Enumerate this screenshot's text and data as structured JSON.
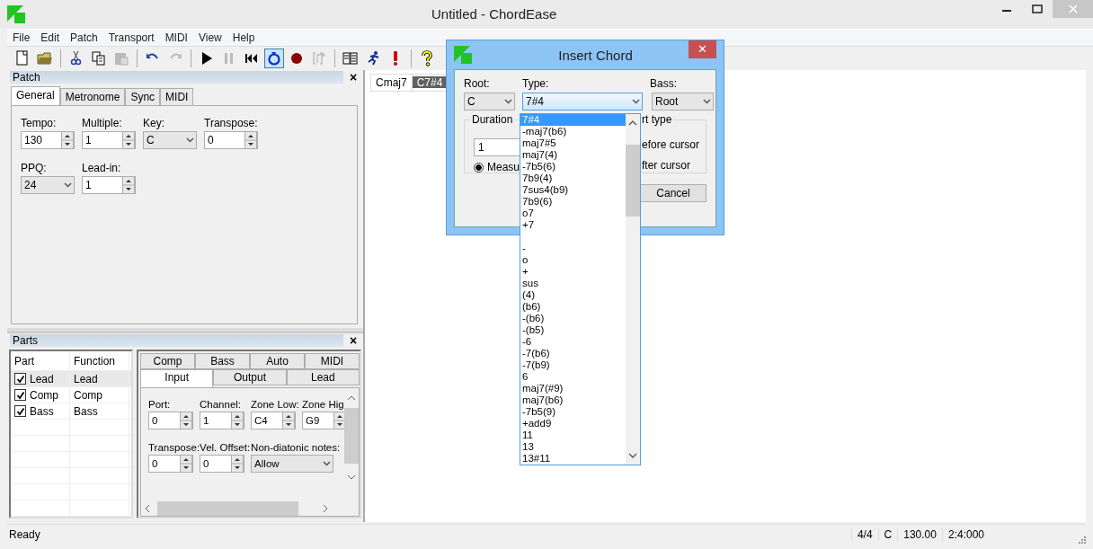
{
  "window": {
    "title": "Untitled - ChordEase"
  },
  "menu": [
    "File",
    "Edit",
    "Patch",
    "Transport",
    "MIDI",
    "View",
    "Help"
  ],
  "toolbar": [
    {
      "kind": "new",
      "disabled": false,
      "active": false
    },
    {
      "kind": "open",
      "disabled": false,
      "active": false
    },
    {
      "kind": "sep"
    },
    {
      "kind": "cut",
      "disabled": false,
      "active": false
    },
    {
      "kind": "copy",
      "disabled": false,
      "active": false
    },
    {
      "kind": "paste",
      "disabled": true,
      "active": false
    },
    {
      "kind": "sep"
    },
    {
      "kind": "undo",
      "disabled": false,
      "active": false
    },
    {
      "kind": "redo",
      "disabled": true,
      "active": false
    },
    {
      "kind": "sep"
    },
    {
      "kind": "play",
      "disabled": false,
      "active": false
    },
    {
      "kind": "pause",
      "disabled": true,
      "active": false
    },
    {
      "kind": "rewind",
      "disabled": false,
      "active": false
    },
    {
      "kind": "loop",
      "disabled": false,
      "active": true
    },
    {
      "kind": "record",
      "disabled": false,
      "active": false
    },
    {
      "kind": "punch",
      "disabled": true,
      "active": false
    },
    {
      "kind": "sep"
    },
    {
      "kind": "book",
      "disabled": false,
      "active": false
    },
    {
      "kind": "run",
      "disabled": false,
      "active": false
    },
    {
      "kind": "alert",
      "disabled": false,
      "active": false
    },
    {
      "kind": "sep"
    },
    {
      "kind": "help",
      "disabled": false,
      "active": false
    }
  ],
  "patch_panel": {
    "title": "Patch",
    "close": "×",
    "tabs": [
      {
        "label": "General",
        "selected": true
      },
      {
        "label": "Metronome",
        "selected": false
      },
      {
        "label": "Sync",
        "selected": false
      },
      {
        "label": "MIDI",
        "selected": false
      }
    ],
    "rows": [
      [
        {
          "label": "Tempo:",
          "value": "130",
          "kind": "spin"
        },
        {
          "label": "Multiple:",
          "value": "1",
          "kind": "spin"
        },
        {
          "label": "Key:",
          "value": "C",
          "kind": "combo"
        },
        {
          "label": "Transpose:",
          "value": "0",
          "kind": "spin"
        }
      ],
      [
        {
          "label": "PPQ:",
          "value": "24",
          "kind": "combo"
        },
        {
          "label": "Lead-in:",
          "value": "1",
          "kind": "spin"
        }
      ]
    ]
  },
  "parts_panel": {
    "title": "Parts",
    "close": "×",
    "columns": [
      "Part",
      "Function"
    ],
    "rows": [
      {
        "part": "Lead",
        "function": "Lead",
        "checked": true,
        "selected": true
      },
      {
        "part": "Comp",
        "function": "Comp",
        "checked": true,
        "selected": false
      },
      {
        "part": "Bass",
        "function": "Bass",
        "checked": true,
        "selected": false
      }
    ],
    "tabs_top": [
      {
        "label": "Comp",
        "selected": false
      },
      {
        "label": "Bass",
        "selected": false
      },
      {
        "label": "Auto",
        "selected": false
      },
      {
        "label": "MIDI",
        "selected": false
      }
    ],
    "tabs_bottom": [
      {
        "label": "Input",
        "selected": true
      },
      {
        "label": "Output",
        "selected": false
      },
      {
        "label": "Lead",
        "selected": false
      }
    ],
    "rows_fields": [
      [
        {
          "label": "Port:",
          "value": "0",
          "kind": "spin"
        },
        {
          "label": "Channel:",
          "value": "1",
          "kind": "spin"
        },
        {
          "label": "Zone Low:",
          "value": "C4",
          "kind": "spin"
        },
        {
          "label": "Zone Hig",
          "value": "G9",
          "kind": "spin"
        }
      ],
      [
        {
          "label": "Transpose:",
          "value": "0",
          "kind": "spin"
        },
        {
          "label": "Vel. Offset:",
          "value": "0",
          "kind": "spin"
        },
        {
          "label": "Non-diatonic notes:",
          "value": "Allow",
          "kind": "combo"
        }
      ]
    ]
  },
  "chord_strip": [
    {
      "label": "Cmaj7",
      "selected": false
    },
    {
      "label": "C7#4",
      "selected": true
    }
  ],
  "dialog": {
    "title": "Insert Chord",
    "close": "✕",
    "root": {
      "label": "Root:",
      "value": "C"
    },
    "type": {
      "label": "Type:",
      "value": "7#4"
    },
    "bass": {
      "label": "Bass:",
      "value": "Root"
    },
    "duration": {
      "label": "Duration",
      "value": "1",
      "radio": "Measu",
      "radio_selected": true
    },
    "insert_type": {
      "label": "rt type",
      "options": [
        "efore cursor",
        "fter cursor"
      ]
    },
    "cancel": "Cancel",
    "type_list": [
      {
        "label": "7#4",
        "selected": true
      },
      {
        "label": "-maj7(b6)",
        "selected": false
      },
      {
        "label": "maj7#5",
        "selected": false
      },
      {
        "label": "maj7(4)",
        "selected": false
      },
      {
        "label": "-7b5(6)",
        "selected": false
      },
      {
        "label": "7b9(4)",
        "selected": false
      },
      {
        "label": "7sus4(b9)",
        "selected": false
      },
      {
        "label": "7b9(6)",
        "selected": false
      },
      {
        "label": "o7",
        "selected": false
      },
      {
        "label": "+7",
        "selected": false
      },
      {
        "kind": "blank"
      },
      {
        "label": "-",
        "selected": false
      },
      {
        "label": "o",
        "selected": false
      },
      {
        "label": "+",
        "selected": false
      },
      {
        "label": "sus",
        "selected": false
      },
      {
        "label": "(4)",
        "selected": false
      },
      {
        "label": "(b6)",
        "selected": false
      },
      {
        "label": "-(b6)",
        "selected": false
      },
      {
        "label": "-(b5)",
        "selected": false
      },
      {
        "label": "-6",
        "selected": false
      },
      {
        "label": "-7(b6)",
        "selected": false
      },
      {
        "label": "-7(b9)",
        "selected": false
      },
      {
        "label": "6",
        "selected": false
      },
      {
        "label": "maj7(#9)",
        "selected": false
      },
      {
        "label": "maj7(b6)",
        "selected": false
      },
      {
        "label": "-7b5(9)",
        "selected": false
      },
      {
        "label": "+add9",
        "selected": false
      },
      {
        "label": "11",
        "selected": false
      },
      {
        "label": "13",
        "selected": false
      },
      {
        "label": "13#11",
        "selected": false
      }
    ]
  },
  "status_bar": {
    "text": "Ready",
    "fields": [
      "4/4",
      "C",
      "130.00",
      "2:4:000"
    ]
  }
}
